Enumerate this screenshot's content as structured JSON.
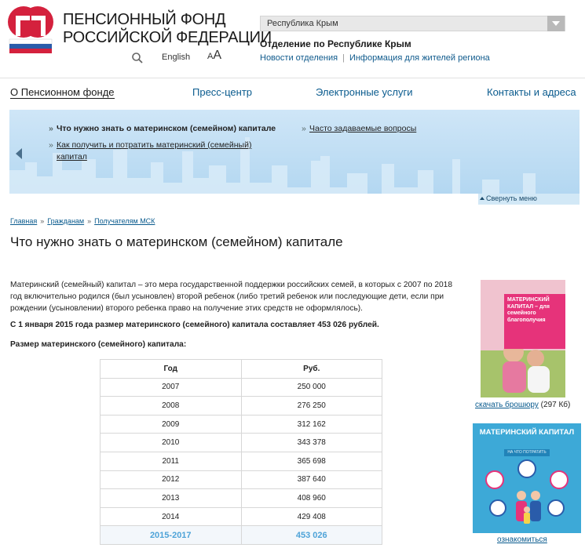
{
  "header": {
    "org_name_line1": "ПЕНСИОННЫЙ ФОНД",
    "org_name_line2": "РОССИЙСКОЙ ФЕДЕРАЦИИ",
    "language_link": "English",
    "font_size_label_small": "A",
    "font_size_label_large": "A",
    "region_select_value": "Республика Крым",
    "branch_title": "Отделение по Республике Крым",
    "branch_links": [
      "Новости отделения",
      "Информация для жителей региона"
    ]
  },
  "main_nav": {
    "items": [
      {
        "label": "О Пенсионном фонде",
        "active": true
      },
      {
        "label": "Пресс-центр",
        "active": false
      },
      {
        "label": "Электронные услуги",
        "active": false
      },
      {
        "label": "Контакты и адреса",
        "active": false
      }
    ]
  },
  "submenu": {
    "links": [
      {
        "label": "Что нужно знать о материнском (семейном) капитале",
        "current": true
      },
      {
        "label": "Как получить и потратить материнский (семейный) капитал",
        "current": false
      },
      {
        "label": "Часто задаваемые вопросы",
        "current": false
      }
    ],
    "collapse_label": "Свернуть меню"
  },
  "breadcrumb": [
    "Главная",
    "Гражданам",
    "Получателям МСК"
  ],
  "page_title": "Что нужно знать о материнском (семейном) капитале",
  "article": {
    "intro": "Материнский (семейный) капитал – это мера государственной поддержки российских семей, в которых с 2007 по 2018 год включительно родился (был усыновлен) второй ребенок (либо третий ребенок или последующие дети, если при рождении (усыновлении) второго ребенка право на получение этих средств не оформлялось).",
    "highlight": "С 1 января 2015 года размер материнского (семейного) капитала составляет 453 026 рублей.",
    "table_heading": "Размер материнского (семейного) капитала:",
    "table": {
      "columns": [
        "Год",
        "Руб."
      ],
      "rows": [
        [
          "2007",
          "250 000"
        ],
        [
          "2008",
          "276 250"
        ],
        [
          "2009",
          "312 162"
        ],
        [
          "2010",
          "343 378"
        ],
        [
          "2011",
          "365 698"
        ],
        [
          "2012",
          "387 640"
        ],
        [
          "2013",
          "408 960"
        ],
        [
          "2014",
          "429 408"
        ]
      ],
      "total_row": [
        "2015-2017",
        "453 026"
      ]
    }
  },
  "sidebar": {
    "brochure_cover_text": "МАТЕРИНСКИЙ КАПИТАЛ – для семейного благополучия",
    "brochure_link": "скачать брошюру",
    "brochure_size": "(297 Кб)",
    "poster_title": "МАТЕРИНСКИЙ КАПИТАЛ",
    "poster_subtitle": "НА ЧТО ПОТРАТИТЬ",
    "poster_link": "ознакомиться"
  },
  "colors": {
    "link_blue": "#0a5b8e",
    "total_row_blue": "#4ea3d8",
    "banner_blue": "#b3d7f1",
    "brand_red": "#d4213d"
  }
}
